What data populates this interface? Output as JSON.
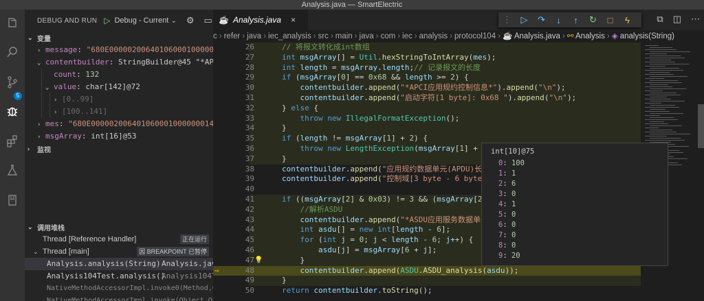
{
  "window": {
    "title": "Analysis.java — SmartElectric"
  },
  "activity_bar": {
    "scm_badge": "5"
  },
  "run": {
    "section_label": "DEBUG AND RUN",
    "config_value": "Debug - Current F"
  },
  "variables": {
    "header": "变量",
    "rows": [
      {
        "arrow": "›",
        "name": "message",
        "sep": ": ",
        "value": "\"680E000002006401060001000000014\"",
        "vkind": "vstr",
        "indent": 0
      },
      {
        "arrow": "⌄",
        "name": "contentbuilder",
        "sep": ": ",
        "value": "StringBuilder@45 \"*APCI应用…",
        "vkind": "vtype",
        "indent": 0
      },
      {
        "arrow": "",
        "name": "count",
        "sep": ": ",
        "value": "132",
        "vkind": "vnum",
        "indent": 1
      },
      {
        "arrow": "⌄",
        "name": "value",
        "sep": ": ",
        "value": "char[142]@72",
        "vkind": "vtype",
        "indent": 1
      },
      {
        "arrow": "›",
        "name": "[0..99]",
        "sep": "",
        "value": "",
        "vkind": "vgray",
        "indent": 2
      },
      {
        "arrow": "›",
        "name": "[100..141]",
        "sep": "",
        "value": "",
        "vkind": "vgray",
        "indent": 2
      },
      {
        "arrow": "›",
        "name": "mes",
        "sep": ": ",
        "value": "\"680E000002006401060001000000014\"",
        "vkind": "vstr",
        "indent": 0
      },
      {
        "arrow": "›",
        "name": "msgArray",
        "sep": ": ",
        "value": "int[16]@53",
        "vkind": "vtype",
        "indent": 0
      }
    ]
  },
  "watch": {
    "header": "监视"
  },
  "callstack": {
    "header": "调用堆栈",
    "threads": [
      {
        "label": "Thread [Reference Handler]",
        "tag": "正在运行"
      },
      {
        "label": "Thread [main]",
        "tag": "因 BREAKPOINT 已暂停"
      }
    ],
    "frames": [
      {
        "method": "Analysis.analysis(String)",
        "file": "Analysis.java",
        "dim": false
      },
      {
        "method": "Analysis104Test.analysis()",
        "file": "Analysis104Te…",
        "dim": false
      },
      {
        "method": "NativeMethodAccessorImpl.invoke0(Method,Obje",
        "file": "",
        "dim": true
      },
      {
        "method": "NativeMethodAccessorImpl.invoke(Object,Objec",
        "file": "",
        "dim": true
      }
    ]
  },
  "editor": {
    "tab_label": "Analysis.java",
    "breadcrumb": [
      "c",
      "refer",
      "java",
      "iec_analysis",
      "src",
      "main",
      "java",
      "com",
      "iec",
      "analysis",
      "protocol104",
      "Analysis.java",
      "Analysis",
      "analysis(String)"
    ],
    "lines": [
      {
        "n": "26",
        "html": "<span class='cm'>// 将报文转化成int数组</span>"
      },
      {
        "n": "27",
        "html": "<span class='kw'>int</span> <span class='va'>msgArray</span>[] = <span class='ty'>Util</span>.<span class='fn'>hexStringToIntArray</span>(<span class='va'>mes</span>);"
      },
      {
        "n": "28",
        "html": "<span class='kw'>int</span> <span class='va'>length</span> = <span class='va'>msgArray</span>.<span class='va'>length</span>;<span class='cm'>// 记录报文的长度</span>"
      },
      {
        "n": "29",
        "html": "<span class='kw'>if</span> (<span class='va'>msgArray</span>[<span class='nm'>0</span>] == <span class='nm'>0x68</span> &amp;&amp; <span class='va'>length</span> &gt;= <span class='nm'>2</span>) {"
      },
      {
        "n": "30",
        "html": "    <span class='va'>contentbuilder</span>.<span class='fn'>append</span>(<span class='st'>\"*APCI应用规约控制信息*\"</span>).<span class='fn'>append</span>(<span class='st'>\"\\n\"</span>);"
      },
      {
        "n": "31",
        "html": "    <span class='va'>contentbuilder</span>.<span class='fn'>append</span>(<span class='st'>\"启动字符[1 byte]: 0x68 \"</span>).<span class='fn'>append</span>(<span class='st'>\"\\n\"</span>);"
      },
      {
        "n": "32",
        "html": "} <span class='kw'>else</span> {"
      },
      {
        "n": "33",
        "html": "    <span class='kw'>throw</span> <span class='kw'>new</span> <span class='ty'>IllegalFormatException</span>();"
      },
      {
        "n": "34",
        "html": "}"
      },
      {
        "n": "35",
        "html": "<span class='kw'>if</span> (<span class='va'>length</span> != <span class='va'>msgArray</span>[<span class='nm'>1</span>] + <span class='nm'>2</span>) {"
      },
      {
        "n": "36",
        "html": "    <span class='kw'>throw</span> <span class='kw'>new</span> <span class='ty'>LengthException</span>(<span class='va'>msgArray</span>[<span class='nm'>1</span>] + <span class='nm'>2</span>, <span class='va'>l</span>"
      },
      {
        "n": "37",
        "html": "}"
      },
      {
        "n": "38",
        "html": "<span class='va'>contentbuilder</span>.<span class='fn'>append</span>(<span class='st'>\"应用规约数据单元(APDU)长度[2</span>"
      },
      {
        "n": "39",
        "html": "<span class='va'>contentbuilder</span>.<span class='fn'>append</span>(<span class='st'>\"控制域[3 byte - 6 byte]: \"</span>)"
      },
      {
        "n": "40",
        "html": ""
      },
      {
        "n": "41",
        "html": "<span class='kw'>if</span> ((<span class='va'>msgArray</span>[<span class='nm'>2</span>] &amp; <span class='nm'>0x03</span>) != <span class='nm'>3</span> &amp;&amp; (<span class='va'>msgArray</span>[<span class='nm'>2</span>] &amp;"
      },
      {
        "n": "42",
        "html": "    <span class='cm'>//解析ASDU</span>"
      },
      {
        "n": "43",
        "html": "    <span class='va'>contentbuilder</span>.<span class='fn'>append</span>(<span class='st'>\"*ASDU应用服务数据单元*\\n</span>"
      },
      {
        "n": "44",
        "html": "    <span class='kw'>int</span> <span class='va'>asdu</span>[] = <span class='kw'>new</span> <span class='kw'>int</span>[<span class='va'>length</span> - <span class='nm'>6</span>];"
      },
      {
        "n": "45",
        "html": "    <span class='kw'>for</span> (<span class='kw'>int</span> <span class='va'>j</span> = <span class='nm'>0</span>; <span class='va'>j</span> &lt; <span class='va'>length</span> - <span class='nm'>6</span>; <span class='va'>j</span>++) {"
      },
      {
        "n": "46",
        "html": "        <span class='va'>asdu</span>[<span class='va'>j</span>] = <span class='va'>msgArray</span>[<span class='nm'>6</span> + <span class='va'>j</span>];"
      },
      {
        "n": "47",
        "html": "    }"
      },
      {
        "n": "48",
        "html": "    <span class='va'>contentbuilder</span>.<span class='fn'>append</span>(<span class='ty'>ASDU</span>.<span class='fn'>ASDU_analysis</span>(<span class='va'>asdu</span>));"
      },
      {
        "n": "49",
        "html": "}"
      },
      {
        "n": "50",
        "html": "<span class='kw'>return</span> <span class='va'>contentbuilder</span>.<span class='fn'>toString</span>();"
      }
    ]
  },
  "hover": {
    "title": "int[10]@75",
    "entries": [
      {
        "k": "0",
        "v": "100"
      },
      {
        "k": "1",
        "v": "1"
      },
      {
        "k": "2",
        "v": "6"
      },
      {
        "k": "3",
        "v": "0"
      },
      {
        "k": "4",
        "v": "1"
      },
      {
        "k": "5",
        "v": "0"
      },
      {
        "k": "6",
        "v": "0"
      },
      {
        "k": "7",
        "v": "0"
      },
      {
        "k": "8",
        "v": "0"
      },
      {
        "k": "9",
        "v": "20"
      }
    ]
  },
  "colors": {
    "accent": "#007acc",
    "current_line": "#4b4a1a",
    "breakpoint_arrow": "#ffcc00"
  }
}
